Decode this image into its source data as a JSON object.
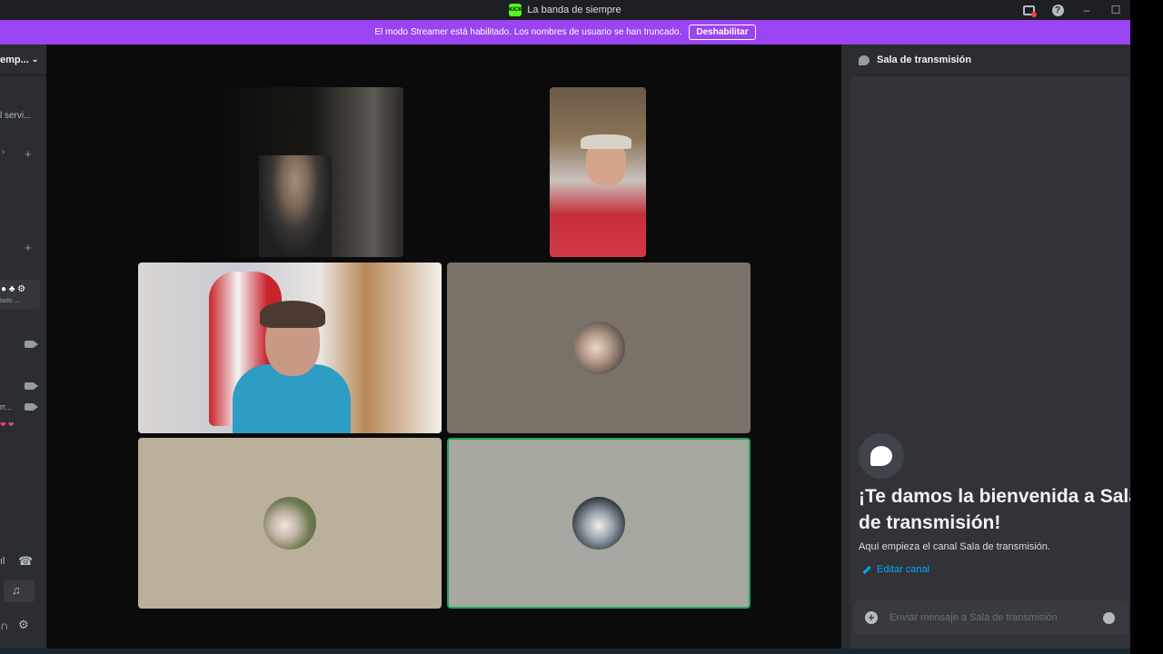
{
  "window": {
    "title": "La banda de siempre",
    "app_icon_text": "KICK"
  },
  "banner": {
    "message": "El modo Streamer está habilitado. Los nombres de usuario se han truncado.",
    "button": "Deshabilitar"
  },
  "sidebar": {
    "server_name": "emp...",
    "text_item": "l servi...",
    "voice_user_status": "tado ...",
    "truncated_user": "rr..."
  },
  "chat": {
    "channel_name": "Sala de transmisión",
    "welcome_title": "¡Te damos la bienvenida a Sala de transmisión!",
    "welcome_subtitle": "Aquí empieza el canal Sala de transmisión.",
    "edit_channel": "Editar canal",
    "input_placeholder": "Enviar mensaje a Sala de transmisión"
  },
  "tiles": [
    {
      "kind": "video",
      "name": "participant-1",
      "bg": "#171513"
    },
    {
      "kind": "video",
      "name": "participant-2",
      "bg": "#5b4a3a"
    },
    {
      "kind": "video",
      "name": "participant-3",
      "bg": "#c9c4be"
    },
    {
      "kind": "avatar",
      "name": "participant-4",
      "bg": "#7a7269"
    },
    {
      "kind": "avatar",
      "name": "participant-5",
      "bg": "#bbb09b"
    },
    {
      "kind": "avatar",
      "name": "participant-6",
      "bg": "#a6a79e",
      "speaking": true
    }
  ],
  "colors": {
    "banner": "#9b44f2",
    "link": "#00a8fc",
    "speaking_border": "#23a55a"
  }
}
